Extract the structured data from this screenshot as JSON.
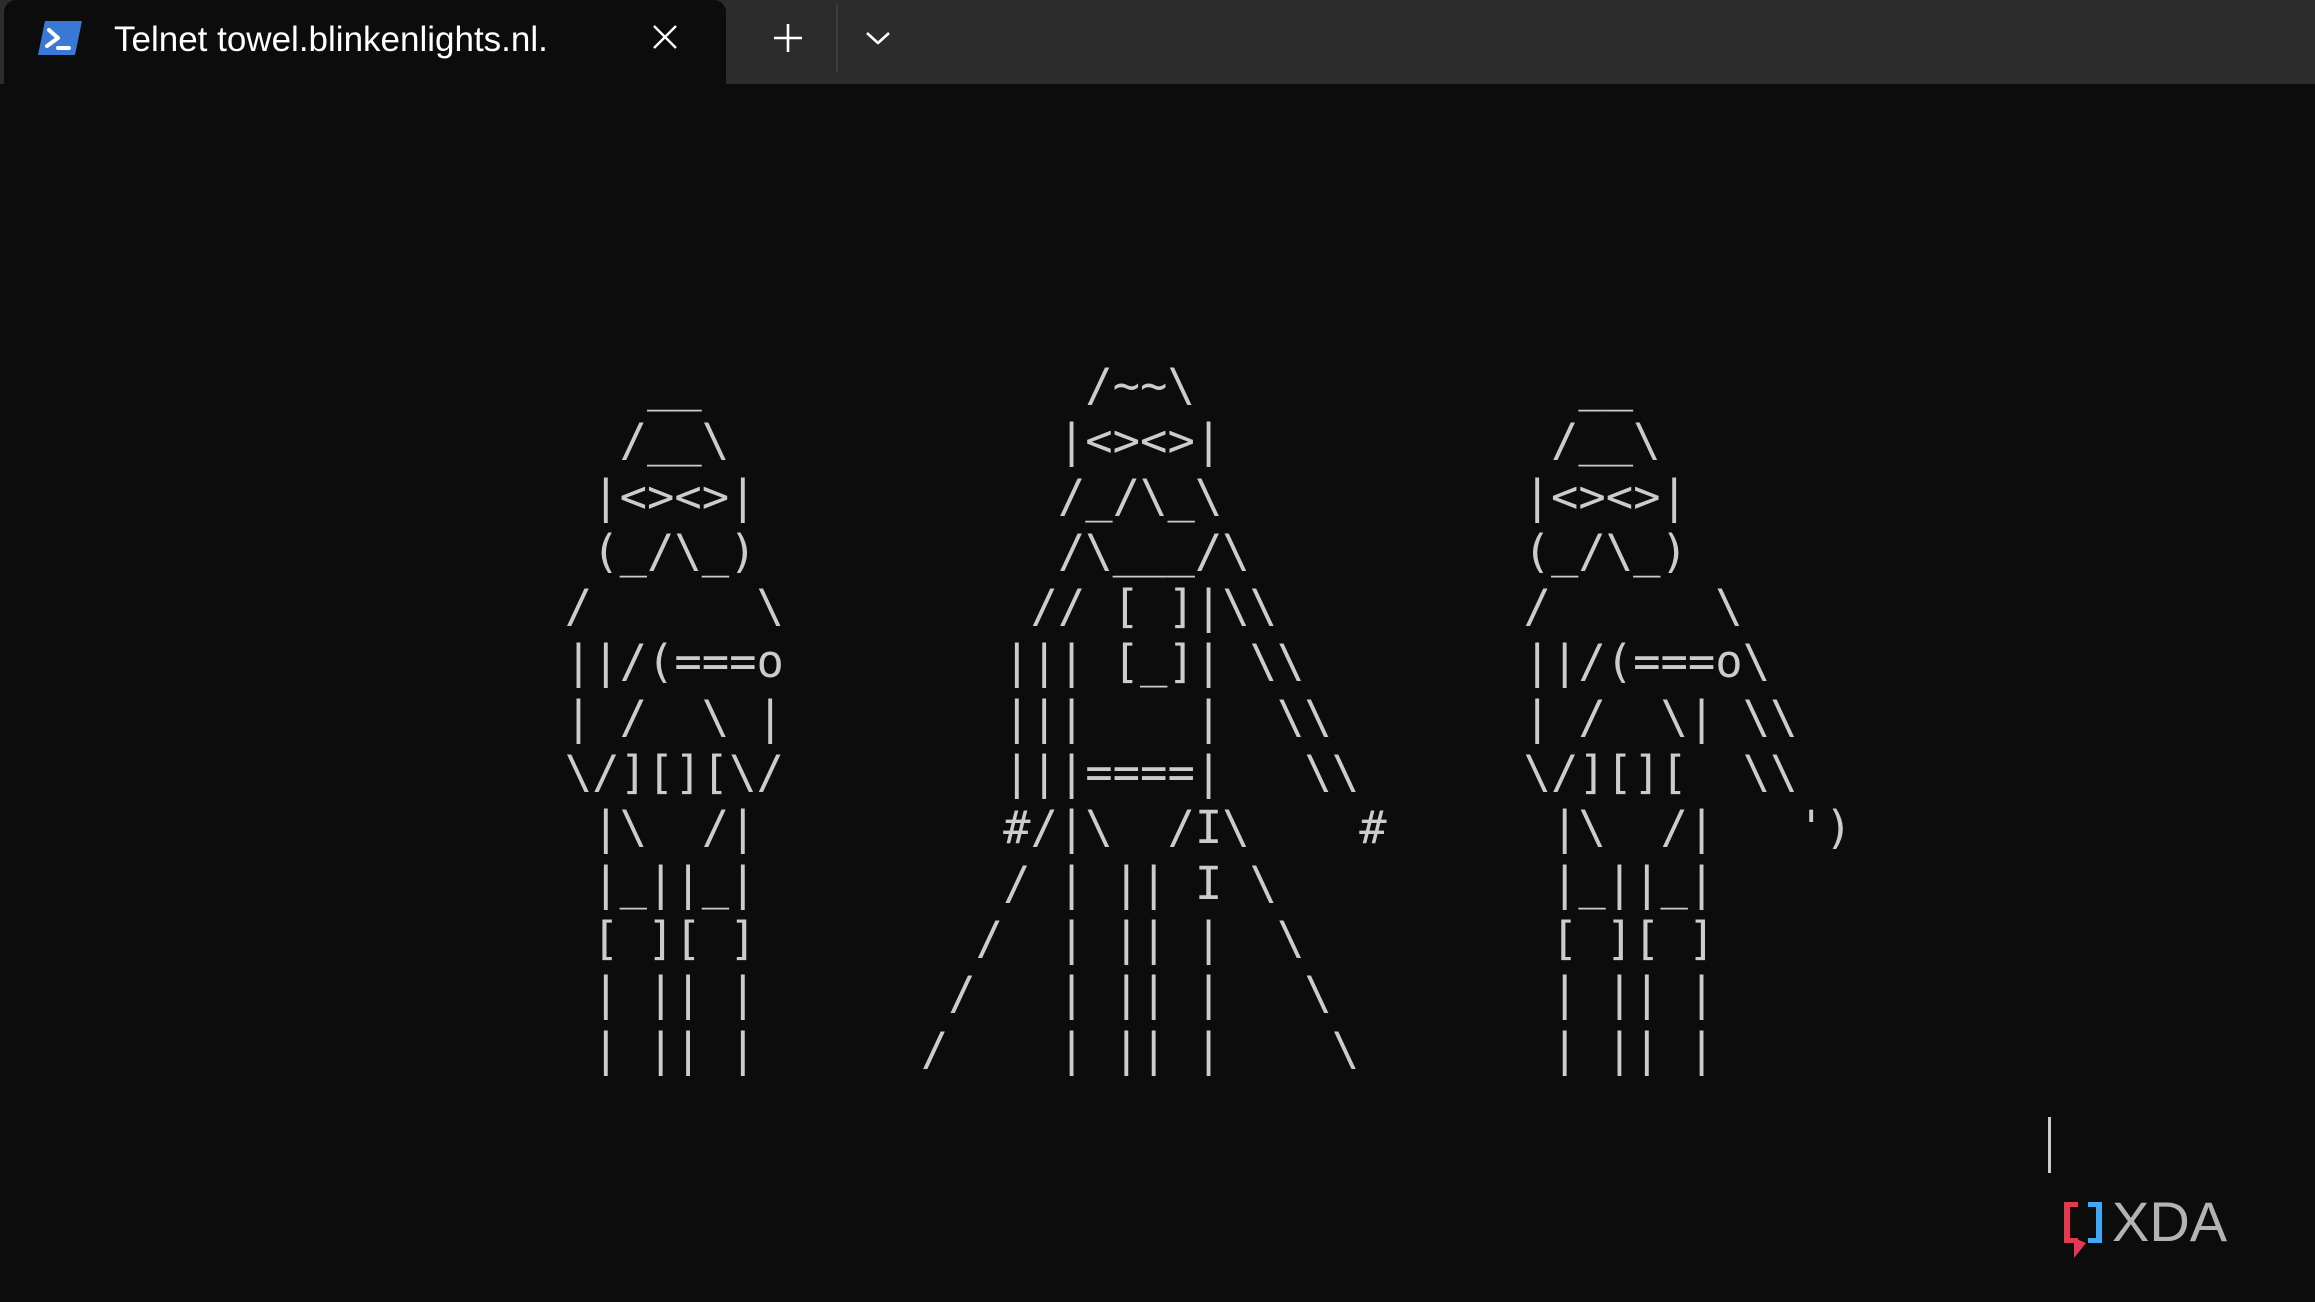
{
  "tab": {
    "title": "Telnet towel.blinkenlights.nl.",
    "icon": "powershell-icon",
    "close_icon": "close-icon"
  },
  "toolbar": {
    "new_tab_icon": "plus-icon",
    "dropdown_icon": "chevron-down-icon"
  },
  "terminal": {
    "ascii_art": "     __              /~~\\              __\n    /__\\            |<><>|            /__\\\n   |<><>|           /_/\\_\\           |<><>|\n   (_/\\_)           /\\___/\\          (_/\\_)\n  /      \\         // [ ]|\\\\         /      \\\n  ||/(===o        ||| [_]| \\\\        ||/(===o\\\n  | /  \\ |        |||    |  \\\\       | /  \\| \\\\\n  \\/][][\\/        |||====|   \\\\      \\/][][  \\\\\n   |\\  /|         #/|\\  /I\\    #      |\\  /|   ')\n   |_||_|         / | || I \\          |_||_|\n   [ ][ ]        /  | || |  \\         [ ][ ]\n   | || |       /   | || |   \\        | || |\n   | || |      /    | || |    \\       | || |"
  },
  "watermark": {
    "text": "XDA",
    "accent_red": "#e53950",
    "accent_blue": "#3fa9f5",
    "text_color": "#b3b3b3"
  },
  "colors": {
    "background": "#0c0c0c",
    "tabbar": "#2c2c2c",
    "text": "#cccccc"
  }
}
